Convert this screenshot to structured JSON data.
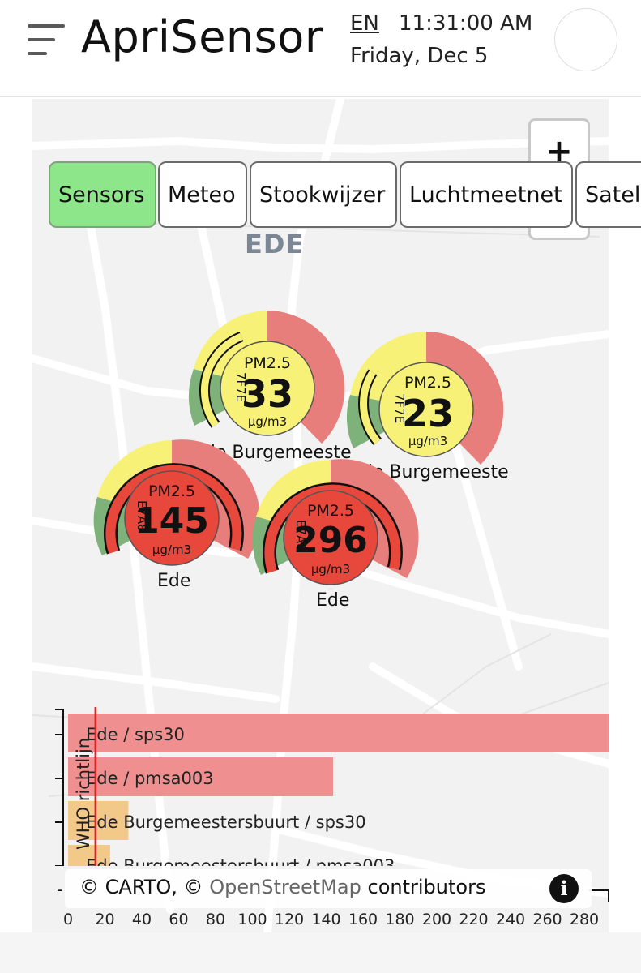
{
  "header": {
    "app_title": "ApriSensor",
    "language": "EN",
    "time": "11:31:00 AM",
    "date": "Friday, Dec 5"
  },
  "map": {
    "city_label": "EDE",
    "zoom_in": "+"
  },
  "tabs": [
    {
      "label": "Sensors",
      "active": true
    },
    {
      "label": "Meteo",
      "active": false
    },
    {
      "label": "Stookwijzer",
      "active": false
    },
    {
      "label": "Luchtmeetnet",
      "active": false
    },
    {
      "label": "Satell",
      "active": false
    }
  ],
  "sensors": [
    {
      "metric": "PM2.5",
      "value": "33",
      "unit": "µg/m3",
      "id": "7F7E",
      "name": "Ede Burgemeeste",
      "level": "yellow"
    },
    {
      "metric": "PM2.5",
      "value": "23",
      "unit": "µg/m3",
      "id": "7F7E",
      "name": "Ede Burgemeeste",
      "level": "yellow"
    },
    {
      "metric": "PM2.5",
      "value": "145",
      "unit": "µg/m3",
      "id": "E7A8",
      "name": "Ede",
      "level": "red"
    },
    {
      "metric": "PM2.5",
      "value": "296",
      "unit": "µg/m3",
      "id": "E7A8",
      "name": "Ede",
      "level": "red"
    }
  ],
  "chart_data": {
    "type": "bar",
    "orientation": "horizontal",
    "categories": [
      "Ede / sps30",
      "Ede / pmsa003",
      "Ede Burgemeestersbuurt / sps30",
      "Ede Burgemeestersbuurt / pmsa003"
    ],
    "values": [
      296,
      145,
      33,
      23
    ],
    "bar_colors": [
      "#ef8f8f",
      "#ef8f8f",
      "#f3c98a",
      "#f3c98a"
    ],
    "reference_line": {
      "label": "WHO richtlijn",
      "value": 15,
      "color": "#d22"
    },
    "x_ticks": [
      "0",
      "20",
      "40",
      "60",
      "80",
      "100",
      "120",
      "140",
      "160",
      "180",
      "200",
      "220",
      "240",
      "260",
      "280"
    ],
    "xlim": [
      0,
      300
    ]
  },
  "attribution": {
    "carto": "© CARTO, ©",
    "osm": "OpenStreetMap",
    "contributors": "contributors",
    "info": "i"
  },
  "colors": {
    "green": "#7fb27a",
    "yellow": "#f7f277",
    "red_soft": "#e77e7b",
    "red": "#e8473c",
    "tab_active": "#8ee68a"
  }
}
